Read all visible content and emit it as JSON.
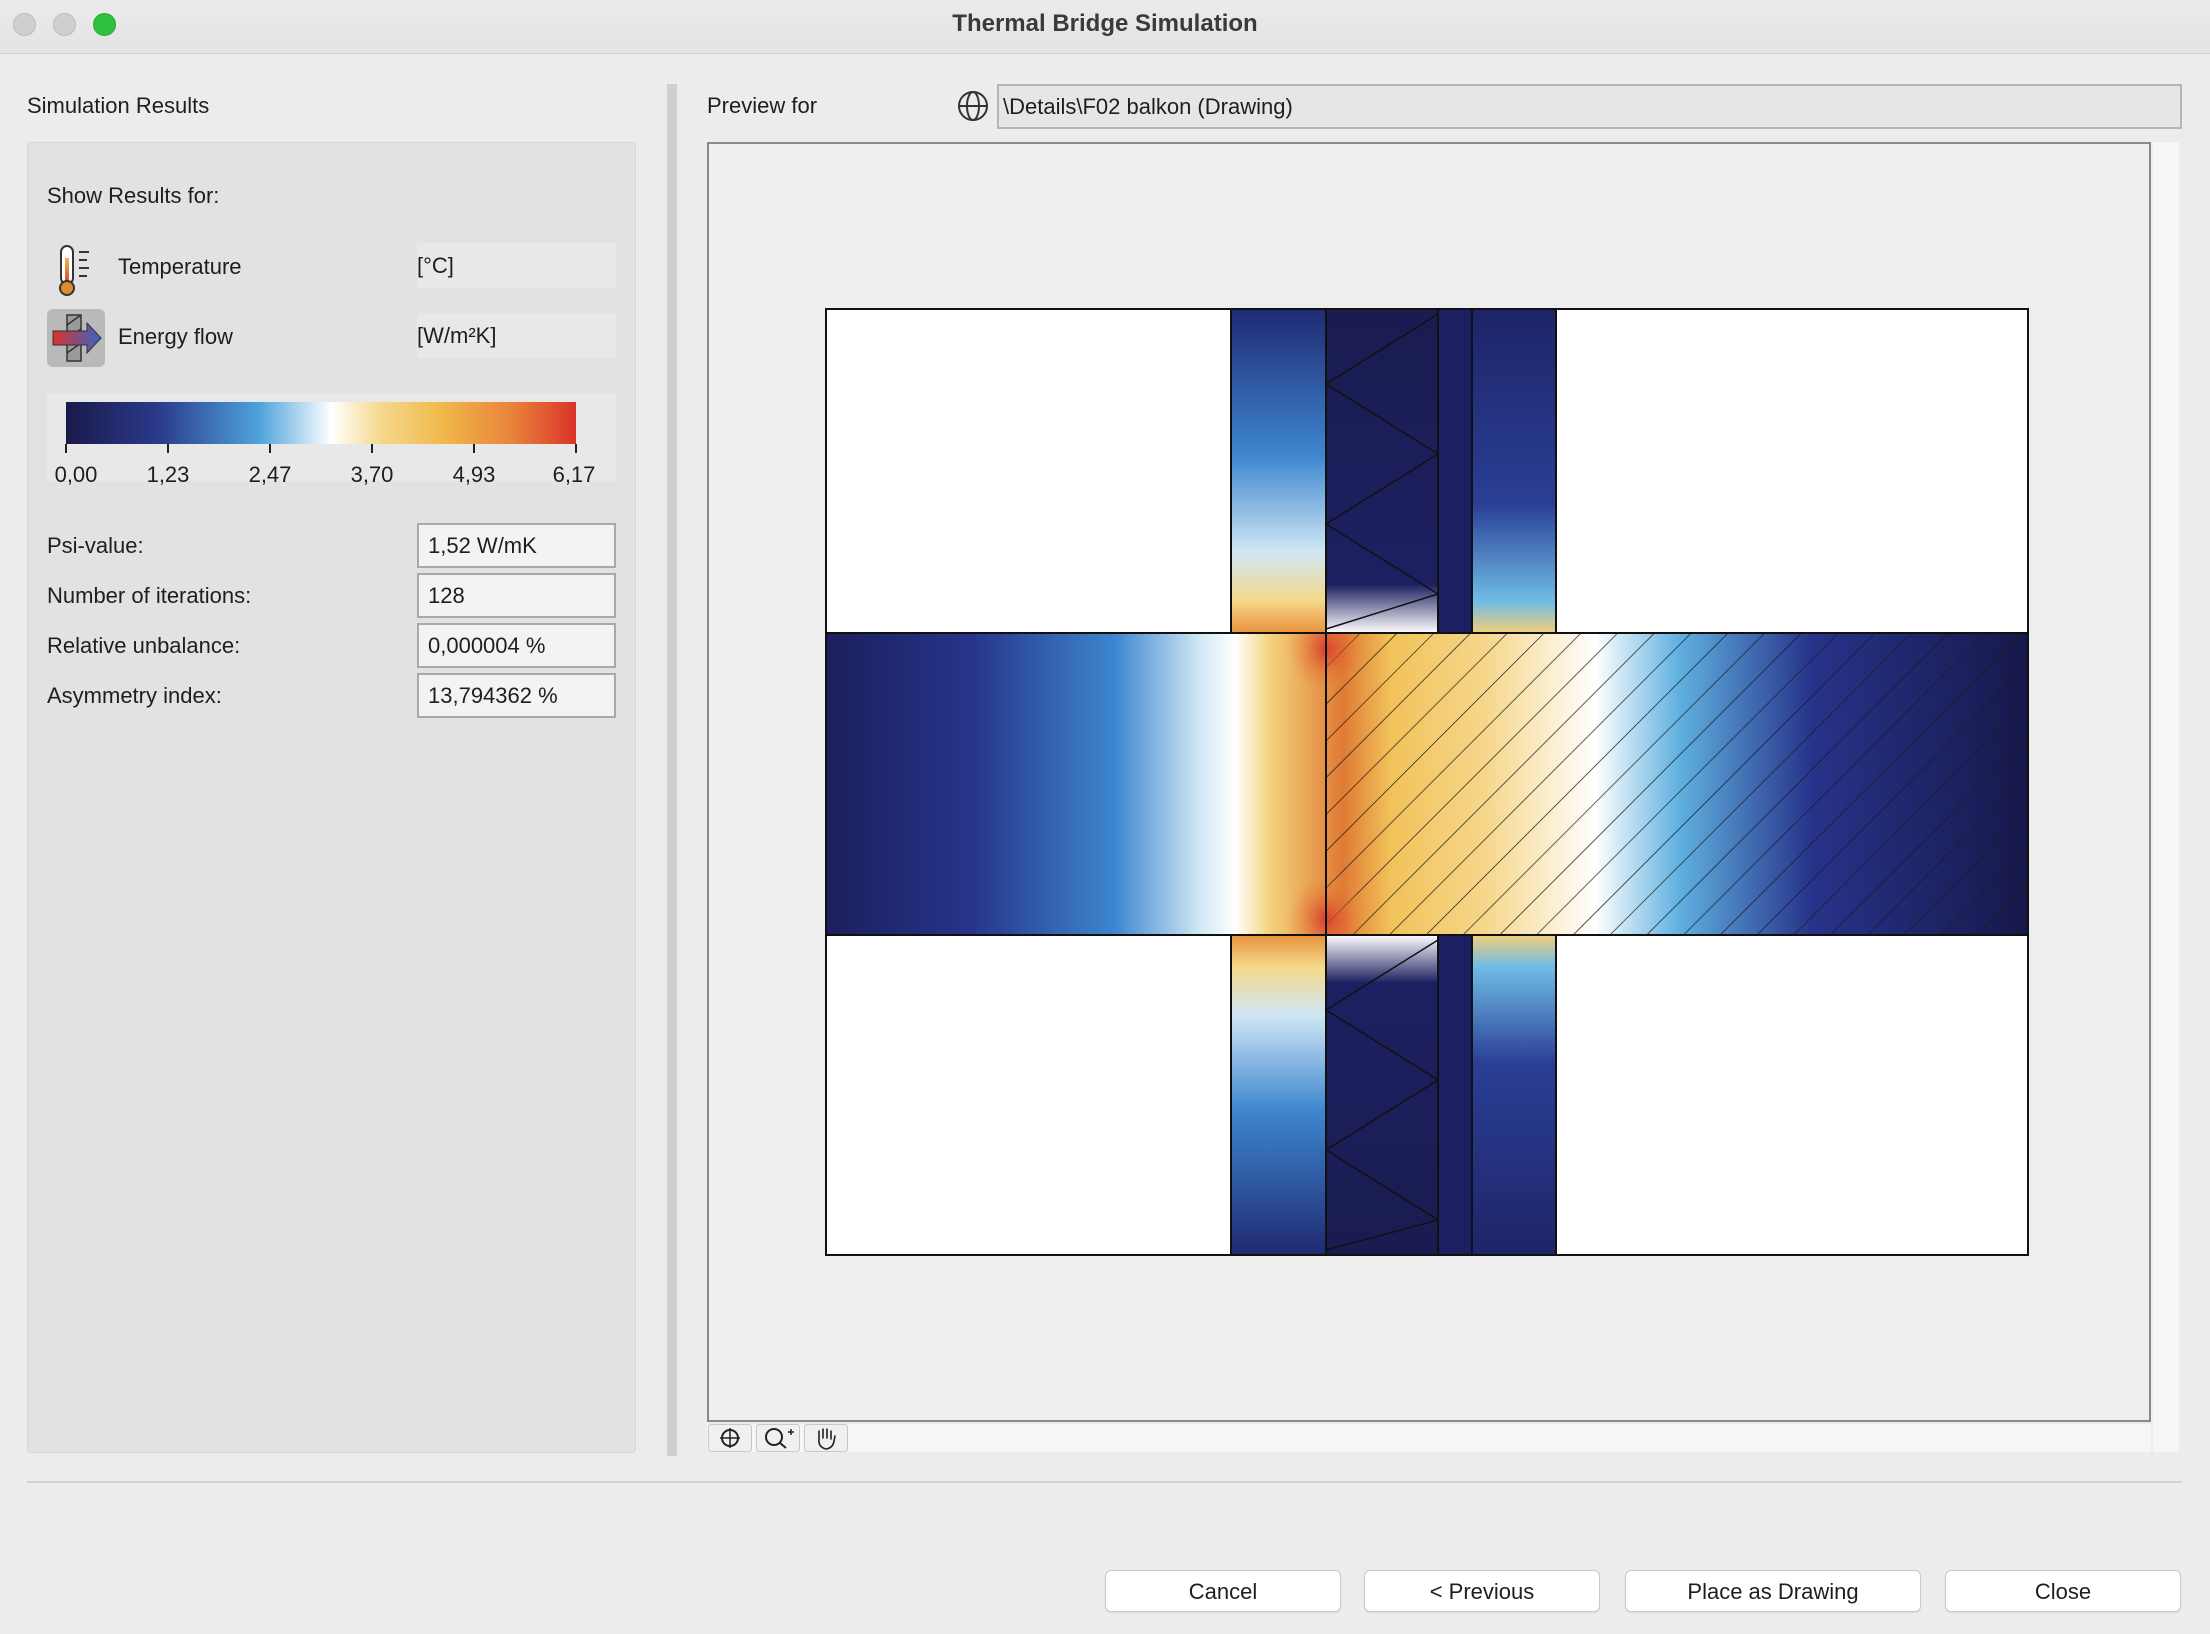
{
  "window": {
    "title": "Thermal Bridge Simulation"
  },
  "left": {
    "section_title": "Simulation Results",
    "show_results_for": "Show Results for:",
    "temperature": {
      "label": "Temperature",
      "unit": "[°C]"
    },
    "energy_flow": {
      "label": "Energy flow",
      "unit": "[W/m²K]"
    },
    "legend_ticks": [
      "0,00",
      "1,23",
      "2,47",
      "3,70",
      "4,93",
      "6,17"
    ],
    "stats": [
      {
        "label": "Psi-value:",
        "value": "1,52 W/mK"
      },
      {
        "label": "Number of iterations:",
        "value": "128"
      },
      {
        "label": "Relative unbalance:",
        "value": "0,000004 %"
      },
      {
        "label": "Asymmetry index:",
        "value": "13,794362 %"
      }
    ]
  },
  "right": {
    "preview_for_label": "Preview for",
    "path": "\\Details\\F02 balkon (Drawing)"
  },
  "buttons": {
    "cancel": "Cancel",
    "previous": "< Previous",
    "place_as_drawing": "Place as Drawing",
    "close": "Close"
  },
  "colors": {
    "scale_low": "#1a1a4a",
    "scale_mid_low": "#4fa3dc",
    "scale_mid": "#ffffff",
    "scale_mid_high": "#f0b84a",
    "scale_high": "#d9332a",
    "traffic_close": "#cfcfcf",
    "traffic_zoom": "#2fc23f"
  },
  "icons": [
    "thermometer-icon",
    "energy-flow-icon",
    "globe-icon",
    "zoom-fit-icon",
    "zoom-icon",
    "pan-hand-icon"
  ]
}
